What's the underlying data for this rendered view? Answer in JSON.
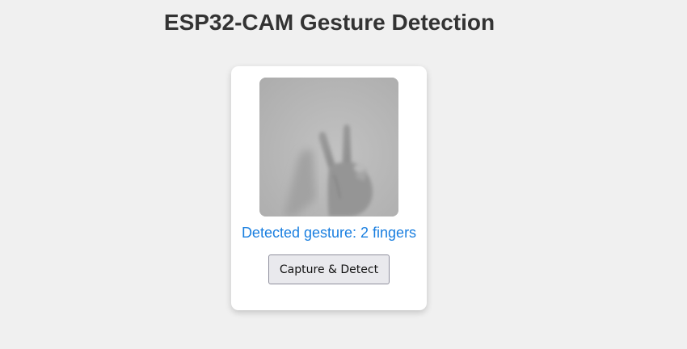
{
  "page": {
    "title": "ESP32-CAM Gesture Detection"
  },
  "camera": {
    "image_description_icon": "camera-frame-hand-two-fingers"
  },
  "result": {
    "text": "Detected gesture: 2 fingers"
  },
  "actions": {
    "capture_label": "Capture & Detect"
  },
  "colors": {
    "background": "#f0f0f0",
    "title": "#333333",
    "result_text": "#1a7fe0",
    "card": "#ffffff",
    "button_bg": "#e9e9ed"
  }
}
